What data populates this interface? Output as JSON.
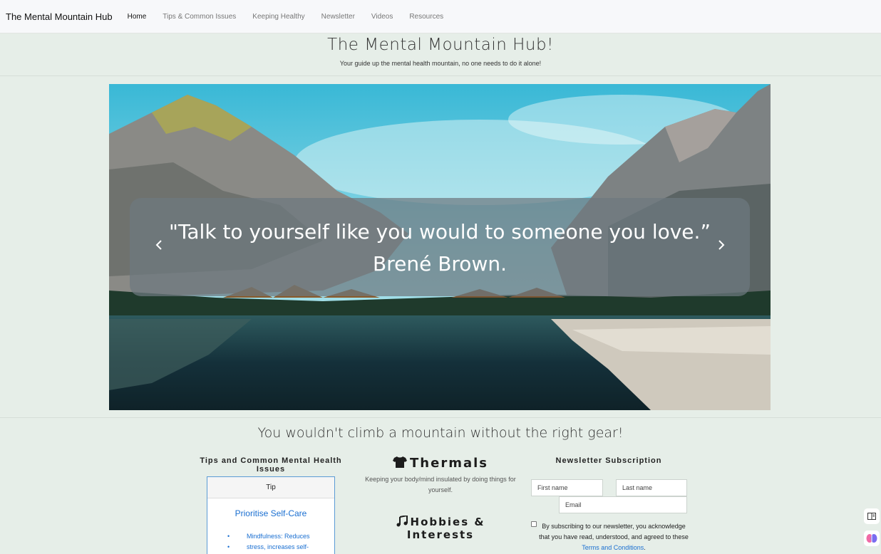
{
  "nav": {
    "brand": "The Mental Mountain Hub",
    "links": [
      {
        "label": "Home",
        "active": true
      },
      {
        "label": "Tips & Common Issues",
        "active": false
      },
      {
        "label": "Keeping Healthy",
        "active": false
      },
      {
        "label": "Newsletter",
        "active": false
      },
      {
        "label": "Videos",
        "active": false
      },
      {
        "label": "Resources",
        "active": false
      }
    ]
  },
  "header": {
    "title": "The Mental Mountain Hub!",
    "tagline": "Your guide up the mental health mountain, no one needs to do it alone!"
  },
  "carousel": {
    "quote": "\"Talk to yourself like you would to someone you love.”",
    "author": "Brené Brown.",
    "prev_icon": "chevron-left-icon",
    "next_icon": "chevron-right-icon"
  },
  "section": {
    "title": "You wouldn't climb a mountain without the right gear!"
  },
  "tips": {
    "heading": "Tips and Common Mental Health Issues",
    "card_header": "Tip",
    "card_title": "Prioritise Self-Care",
    "items": [
      "Mindfulness: Reduces",
      "stress, increases self-"
    ]
  },
  "gear": {
    "thermals_title": "Thermals",
    "thermals_icon": "t-shirt-icon",
    "thermals_desc": "Keeping your body/mind insulated by doing things for yourself.",
    "hobbies_title_1": "Hobbies &",
    "hobbies_title_2": "Interests",
    "hobbies_icon": "music-notes-icon"
  },
  "newsletter": {
    "heading": "Newsletter Subscription",
    "first_name_placeholder": "First name",
    "last_name_placeholder": "Last name",
    "email_placeholder": "Email",
    "consent_text": "By subscribing to our newsletter, you acknowledge that you have read, understood, and agreed to these",
    "terms_link": "Terms and Conditions",
    "terms_end": "."
  },
  "side_icons": [
    "reader-view-icon",
    "brain-extension-icon"
  ],
  "colors": {
    "background": "#e6eee8",
    "navbar": "#f7f8fa",
    "link": "#1a6fd1",
    "quote_overlay": "#6e7880"
  }
}
